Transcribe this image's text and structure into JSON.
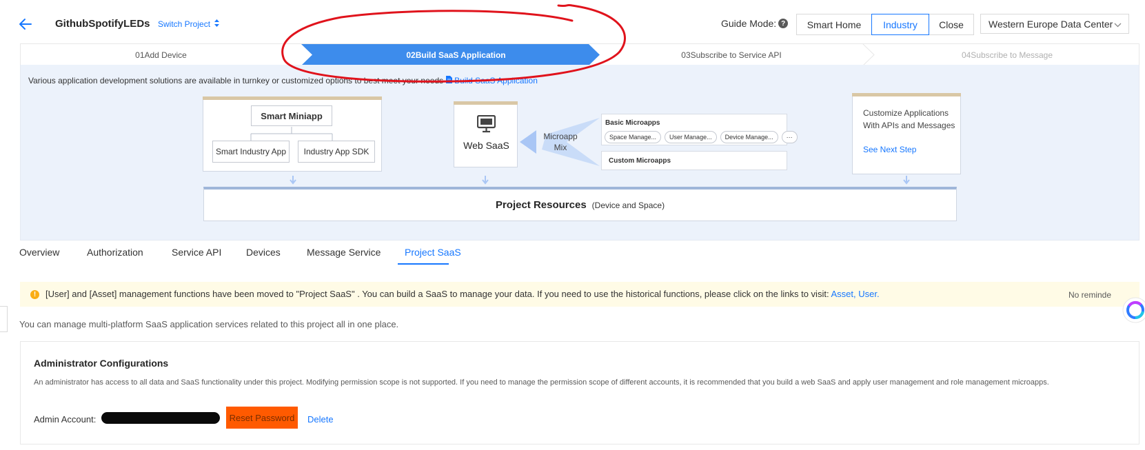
{
  "header": {
    "project_name": "GithubSpotifyLEDs",
    "switch_project": "Switch Project",
    "guide_mode": "Guide Mode:",
    "modes": [
      "Smart Home",
      "Industry",
      "Close"
    ],
    "active_mode": "Industry",
    "region": "Western Europe Data Center"
  },
  "steps": [
    {
      "label": "01Add Device",
      "state": "done"
    },
    {
      "label": "02Build SaaS Application",
      "state": "active"
    },
    {
      "label": "03Subscribe to Service API",
      "state": "todo"
    },
    {
      "label": "04Subscribe to Message",
      "state": "disabled"
    }
  ],
  "banner": {
    "intro": "Various application development solutions are available in turnkey or customized options to best meet your needs",
    "link": "Build SaaS Application",
    "smart_miniapp": "Smart Miniapp",
    "smart_industry_app": "Smart Industry App",
    "industry_app_sdk": "Industry App SDK",
    "web_saas": "Web SaaS",
    "microapp_mix": "Microapp Mix",
    "basic_microapps": "Basic Microapps",
    "basic_pills": [
      "Space Manage...",
      "User Manage...",
      "Device Manage...",
      "···"
    ],
    "custom_microapps": "Custom Microapps",
    "customize": "Customize Applications With APIs and Messages",
    "see_next_step": "See Next Step",
    "project_resources": "Project Resources",
    "project_resources_sub": "(Device and Space)"
  },
  "tabs": [
    "Overview",
    "Authorization",
    "Service API",
    "Devices",
    "Message Service",
    "Project SaaS"
  ],
  "active_tab": "Project SaaS",
  "notice": {
    "text": "[User] and [Asset] management functions have been moved to \"Project SaaS\" . You can build a SaaS to manage your data. If you need to use the historical functions, please click on the links to visit:",
    "link_asset": "Asset,",
    "link_user": "User.",
    "no_remind": "No reminde"
  },
  "description": "You can manage multi-platform SaaS application services related to this project all in one place.",
  "admin": {
    "title": "Administrator Configurations",
    "desc": "An administrator has access to all data and SaaS functionality under this project. Modifying permission scope is not supported. If you need to manage the permission scope of different accounts, it is recommended that you build a web SaaS and apply user management and role management microapps.",
    "account_label": "Admin Account:",
    "reset_password": "Reset Password",
    "delete": "Delete"
  },
  "colors": {
    "accent": "#1677ff",
    "step_active": "#3d8cec",
    "banner_bg": "#ecf2fb",
    "notice_bg": "#fffbe6",
    "highlight_orange": "#ff5a00",
    "annotation_red": "#e0131c"
  },
  "icons": [
    "back-arrow-icon",
    "sort-icon",
    "question-icon",
    "chevron-down-icon",
    "document-icon",
    "monitor-icon",
    "warning-icon",
    "assistant-icon"
  ]
}
